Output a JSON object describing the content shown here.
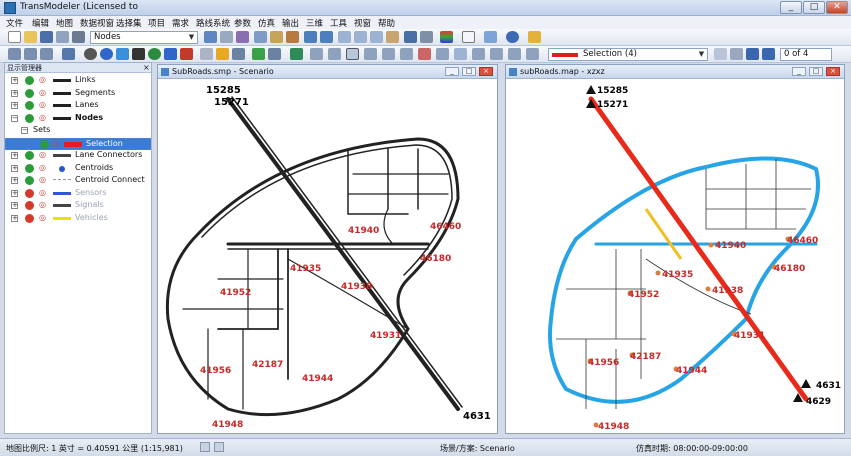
{
  "app": {
    "title": "TransModeler (Licensed to",
    "win_min": "_",
    "win_max": "□",
    "win_close": "✕"
  },
  "menu": [
    "文件",
    "编辑",
    "地图",
    "数据视窗",
    "选择集",
    "项目",
    "需求",
    "路线系统",
    "参数",
    "仿真",
    "输出",
    "三维",
    "工具",
    "视窗",
    "帮助"
  ],
  "toolbar1": {
    "layer_combo": "Nodes"
  },
  "toolbar2": {
    "selection_combo": "Selection (4)",
    "record_counter": "0 of 4",
    "selection_color": "#e02020"
  },
  "layer_panel": {
    "title": "显示管理器",
    "close": "×",
    "layers": [
      {
        "label": "Links",
        "expand": "+",
        "check": "green",
        "swatch": "#222222",
        "bold": false,
        "muted": false
      },
      {
        "label": "Segments",
        "expand": "+",
        "check": "green",
        "swatch": "#222222",
        "bold": false,
        "muted": false
      },
      {
        "label": "Lanes",
        "expand": "+",
        "check": "green",
        "swatch": "#222222",
        "bold": false,
        "muted": false
      },
      {
        "label": "Nodes",
        "expand": "−",
        "check": "green",
        "swatch": "#222222",
        "bold": true,
        "muted": false
      },
      {
        "label": "Sets",
        "expand": "−",
        "check": "none",
        "swatch": "none",
        "bold": false,
        "muted": false
      },
      {
        "label": "Selection",
        "expand": "",
        "check": "green",
        "swatch": "#e02020",
        "bold": false,
        "muted": false,
        "selected": true
      },
      {
        "label": "Lane Connectors",
        "expand": "+",
        "check": "green",
        "swatch": "#444444",
        "bold": false,
        "muted": false
      },
      {
        "label": "Centroids",
        "expand": "+",
        "check": "green",
        "swatch": "#2a55d0",
        "bold": false,
        "muted": false
      },
      {
        "label": "Centroid Connect",
        "expand": "+",
        "check": "green",
        "swatch": "#8899aa",
        "bold": false,
        "muted": false
      },
      {
        "label": "Sensors",
        "expand": "+",
        "check": "red",
        "swatch": "#3355dd",
        "bold": false,
        "muted": true
      },
      {
        "label": "Signals",
        "expand": "+",
        "check": "red",
        "swatch": "#444444",
        "bold": false,
        "muted": true
      },
      {
        "label": "Vehicles",
        "expand": "+",
        "check": "red",
        "swatch": "#e6e600",
        "bold": false,
        "muted": true
      }
    ]
  },
  "left_map": {
    "title": "SubRoads.smp - Scenario",
    "nodes": {
      "n1": "15285",
      "n2": "15271",
      "n3": "4631"
    },
    "zones": [
      "41940",
      "46460",
      "46180",
      "41935",
      "41938",
      "41952",
      "41931",
      "41956",
      "42187",
      "41944",
      "41948"
    ]
  },
  "right_map": {
    "title": "subRoads.map - xzxz",
    "nodes": {
      "n1": "15285",
      "n2": "15271",
      "n3": "4631",
      "n4": "4629"
    },
    "zones": [
      "41940",
      "46460",
      "46180",
      "41935",
      "41938",
      "41952",
      "41931",
      "41956",
      "42187",
      "41944",
      "41948"
    ]
  },
  "status": {
    "scale": "地图比例尺: 1 英寸 = 0.40591 公里 (1:15,981)",
    "scenario": "场景/方案: Scenario",
    "sim_time": "仿真时期: 08:00:00-09:00:00"
  },
  "colors": {
    "road_blue": "#27a4e6",
    "selection_red": "#e82a1a",
    "label_red": "#c82828"
  }
}
